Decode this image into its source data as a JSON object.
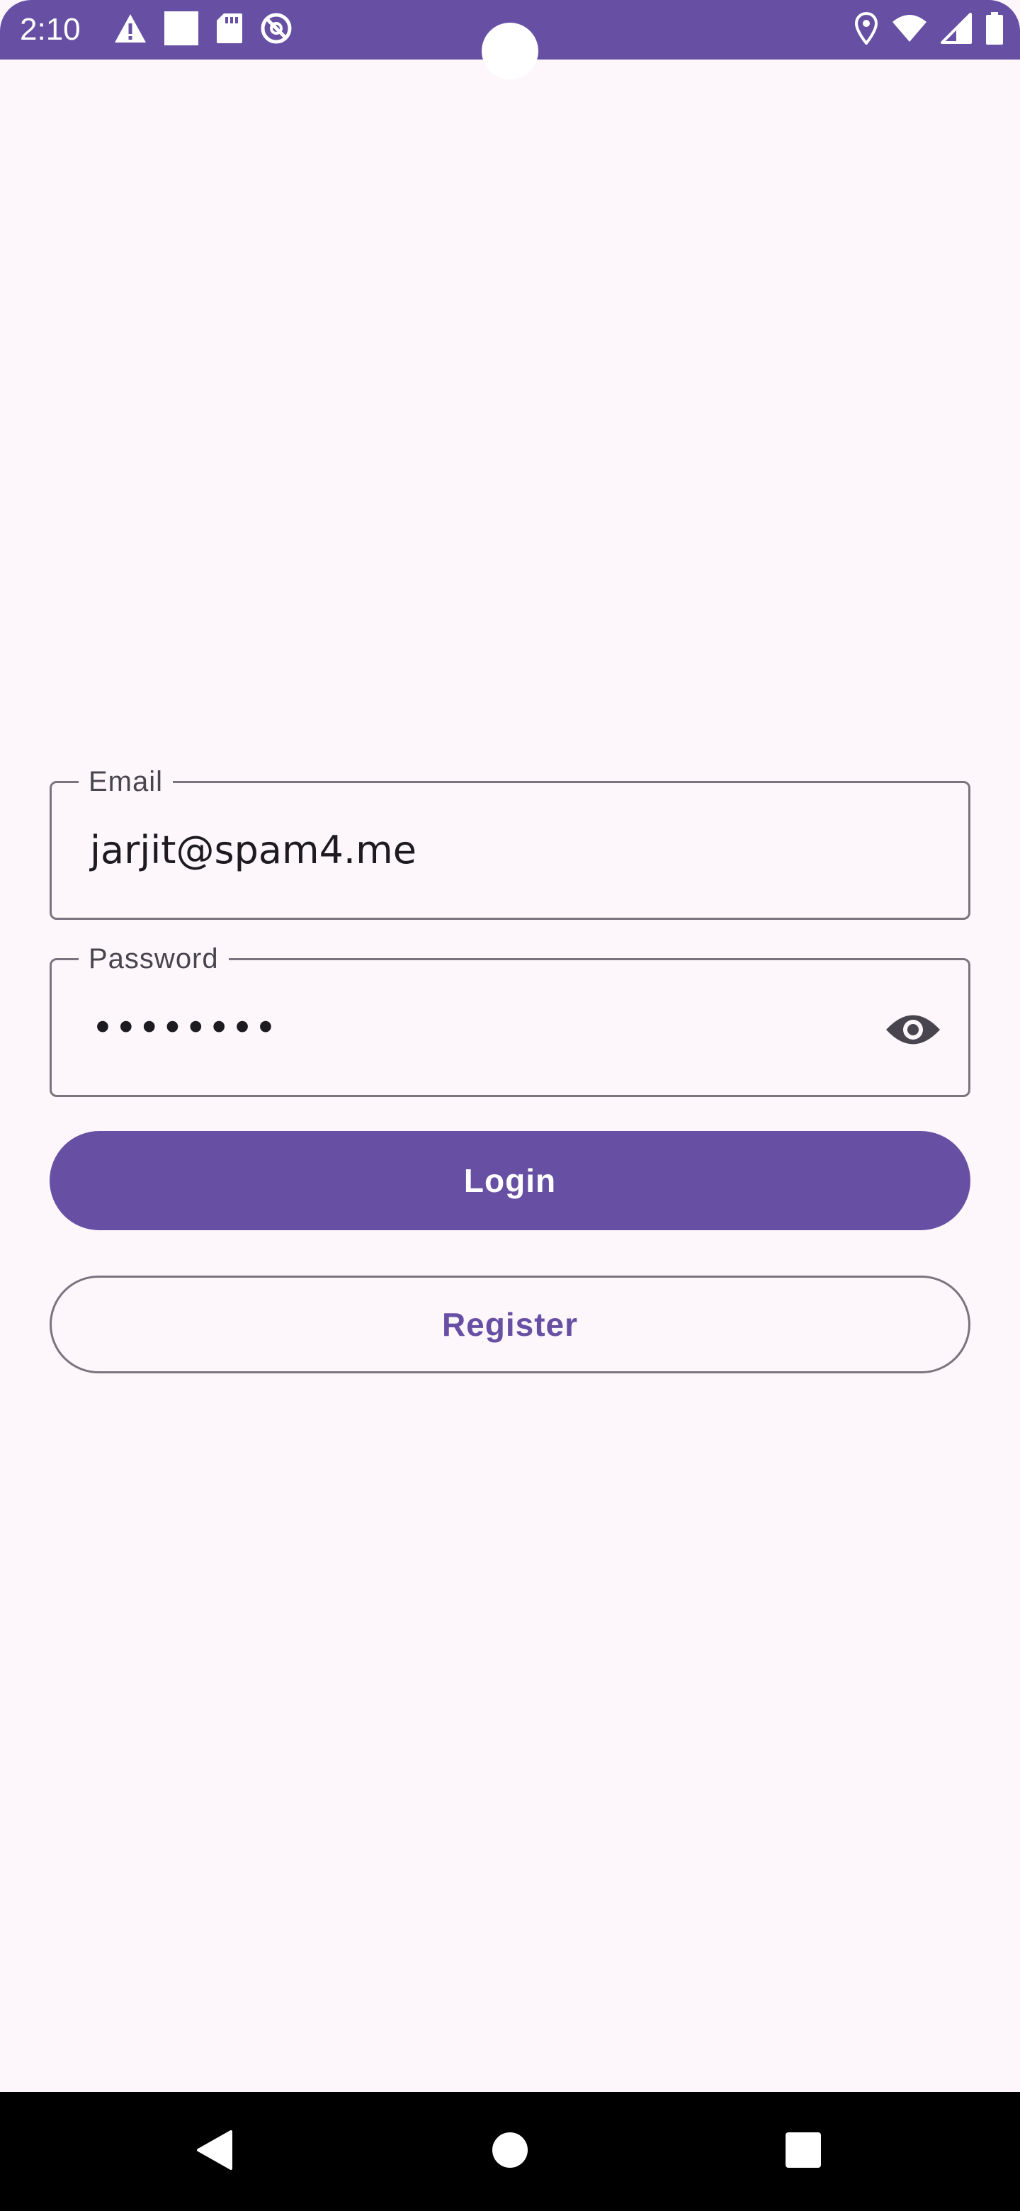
{
  "status_bar": {
    "time": "2:10",
    "left_icons": [
      "warning-icon",
      "square-notification-icon",
      "sd-card-icon",
      "do-not-disturb-icon"
    ],
    "right_icons": [
      "location-icon",
      "wifi-icon",
      "cell-signal-icon",
      "battery-icon"
    ],
    "color": "#6750a4"
  },
  "login_form": {
    "email": {
      "label": "Email",
      "value": "jarjit@spam4.me"
    },
    "password": {
      "label": "Password",
      "masked_value": "••••••••",
      "visibility_icon": "eye-icon"
    },
    "login_label": "Login",
    "register_label": "Register"
  },
  "theme": {
    "primary": "#6750a4",
    "background": "#fdf7fc",
    "outline": "#79747e",
    "on_surface": "#1d1b20"
  },
  "nav_bar": {
    "buttons": [
      "back-icon",
      "home-icon",
      "recents-icon"
    ]
  }
}
